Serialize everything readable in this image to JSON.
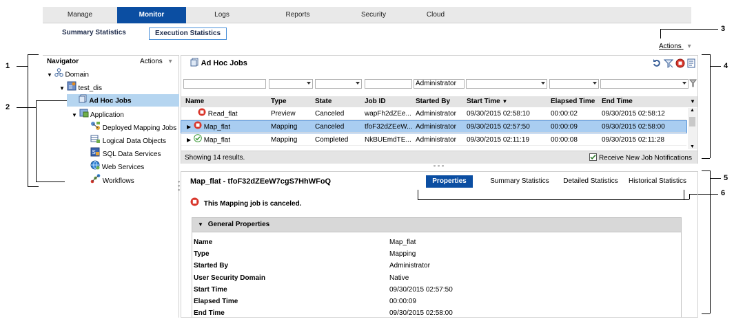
{
  "top_nav": {
    "tabs": [
      {
        "label": "Manage"
      },
      {
        "label": "Monitor",
        "active": true
      },
      {
        "label": "Logs"
      },
      {
        "label": "Reports"
      },
      {
        "label": "Security"
      },
      {
        "label": "Cloud"
      }
    ]
  },
  "sub_tabs": {
    "summary": "Summary Statistics",
    "execution": "Execution Statistics"
  },
  "actions_label": "Actions",
  "callouts": [
    "1",
    "2",
    "3",
    "4",
    "5",
    "6"
  ],
  "navigator": {
    "title": "Navigator",
    "actions": "Actions",
    "items": [
      {
        "label": "Domain",
        "icon": "domain-icon"
      },
      {
        "label": "test_dis",
        "icon": "integration-service-icon"
      },
      {
        "label": "Ad Hoc Jobs",
        "icon": "adhoc-jobs-icon",
        "selected": true
      },
      {
        "label": "Application",
        "icon": "application-icon"
      },
      {
        "label": "Deployed Mapping Jobs",
        "icon": "mapping-jobs-icon"
      },
      {
        "label": "Logical Data Objects",
        "icon": "logical-data-objects-icon"
      },
      {
        "label": "SQL Data Services",
        "icon": "sql-data-services-icon"
      },
      {
        "label": "Web Services",
        "icon": "web-services-icon"
      },
      {
        "label": "Workflows",
        "icon": "workflows-icon"
      }
    ]
  },
  "jobs": {
    "title": "Ad Hoc Jobs",
    "filter_started_by": "Administrator",
    "columns": [
      "Name",
      "Type",
      "State",
      "Job ID",
      "Started By",
      "Start Time",
      "Elapsed Time",
      "End Time"
    ],
    "rows": [
      {
        "name": "Read_flat",
        "type": "Preview",
        "state": "Canceled",
        "job_id": "wapFh2dZEe...",
        "started_by": "Administrator",
        "start": "09/30/2015 02:58:10",
        "elapsed": "00:00:02",
        "end": "09/30/2015 02:58:12",
        "status": "canceled"
      },
      {
        "name": "Map_flat",
        "type": "Mapping",
        "state": "Canceled",
        "job_id": "tfoF32dZEeW...",
        "started_by": "Administrator",
        "start": "09/30/2015 02:57:50",
        "elapsed": "00:00:09",
        "end": "09/30/2015 02:58:00",
        "status": "canceled"
      },
      {
        "name": "Map_flat",
        "type": "Mapping",
        "state": "Completed",
        "job_id": "NkBUEmdTE...",
        "started_by": "Administrator",
        "start": "09/30/2015 02:11:19",
        "elapsed": "00:00:08",
        "end": "09/30/2015 02:11:28",
        "status": "completed"
      }
    ],
    "results": "Showing 14 results.",
    "notify": "Receive New Job Notifications",
    "notify_checked": true
  },
  "details": {
    "title": "Map_flat - tfoF32dZEeW7cgS7HhWFoQ",
    "tabs": [
      "Properties",
      "Summary Statistics",
      "Detailed Statistics",
      "Historical Statistics"
    ],
    "message": "This Mapping job is canceled.",
    "section": "General Properties",
    "properties": [
      {
        "k": "Name",
        "v": "Map_flat"
      },
      {
        "k": "Type",
        "v": "Mapping"
      },
      {
        "k": "Started By",
        "v": "Administrator"
      },
      {
        "k": "User Security Domain",
        "v": "Native"
      },
      {
        "k": "Start Time",
        "v": "09/30/2015 02:57:50"
      },
      {
        "k": "Elapsed Time",
        "v": "00:00:09"
      },
      {
        "k": "End Time",
        "v": "09/30/2015 02:58:00"
      }
    ]
  }
}
